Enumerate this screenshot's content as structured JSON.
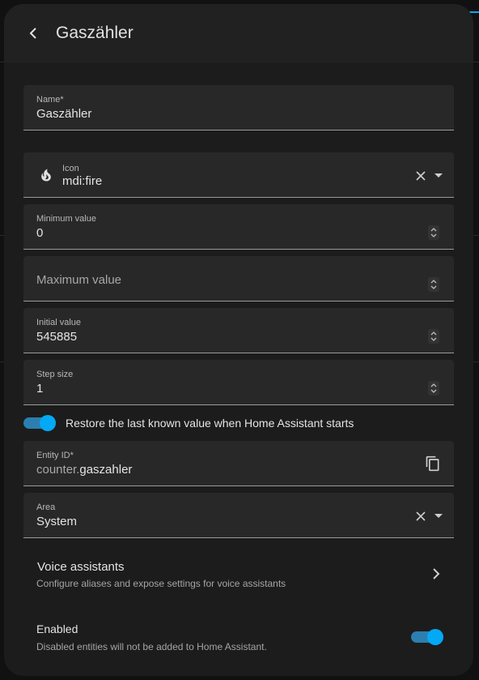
{
  "header": {
    "title": "Gaszähler"
  },
  "fields": {
    "name": {
      "label": "Name*",
      "value": "Gaszähler"
    },
    "icon": {
      "label": "Icon",
      "value": "mdi:fire",
      "icon_name": "fire-icon"
    },
    "minimum": {
      "label": "Minimum value",
      "value": "0"
    },
    "maximum": {
      "placeholder": "Maximum value"
    },
    "initial": {
      "label": "Initial value",
      "value": "545885"
    },
    "step": {
      "label": "Step size",
      "value": "1"
    },
    "entity_id": {
      "label": "Entity ID*",
      "prefix": "counter.",
      "value": "gaszahler"
    },
    "area": {
      "label": "Area",
      "value": "System"
    }
  },
  "restore": {
    "label": "Restore the last known value when Home Assistant starts",
    "checked": true
  },
  "voice": {
    "title": "Voice assistants",
    "subtitle": "Configure aliases and expose settings for voice assistants"
  },
  "enabled": {
    "title": "Enabled",
    "subtitle": "Disabled entities will not be added to Home Assistant.",
    "checked": true
  },
  "colors": {
    "accent": "#03a9f4",
    "surface": "#1c1c1c",
    "field": "#282828"
  }
}
